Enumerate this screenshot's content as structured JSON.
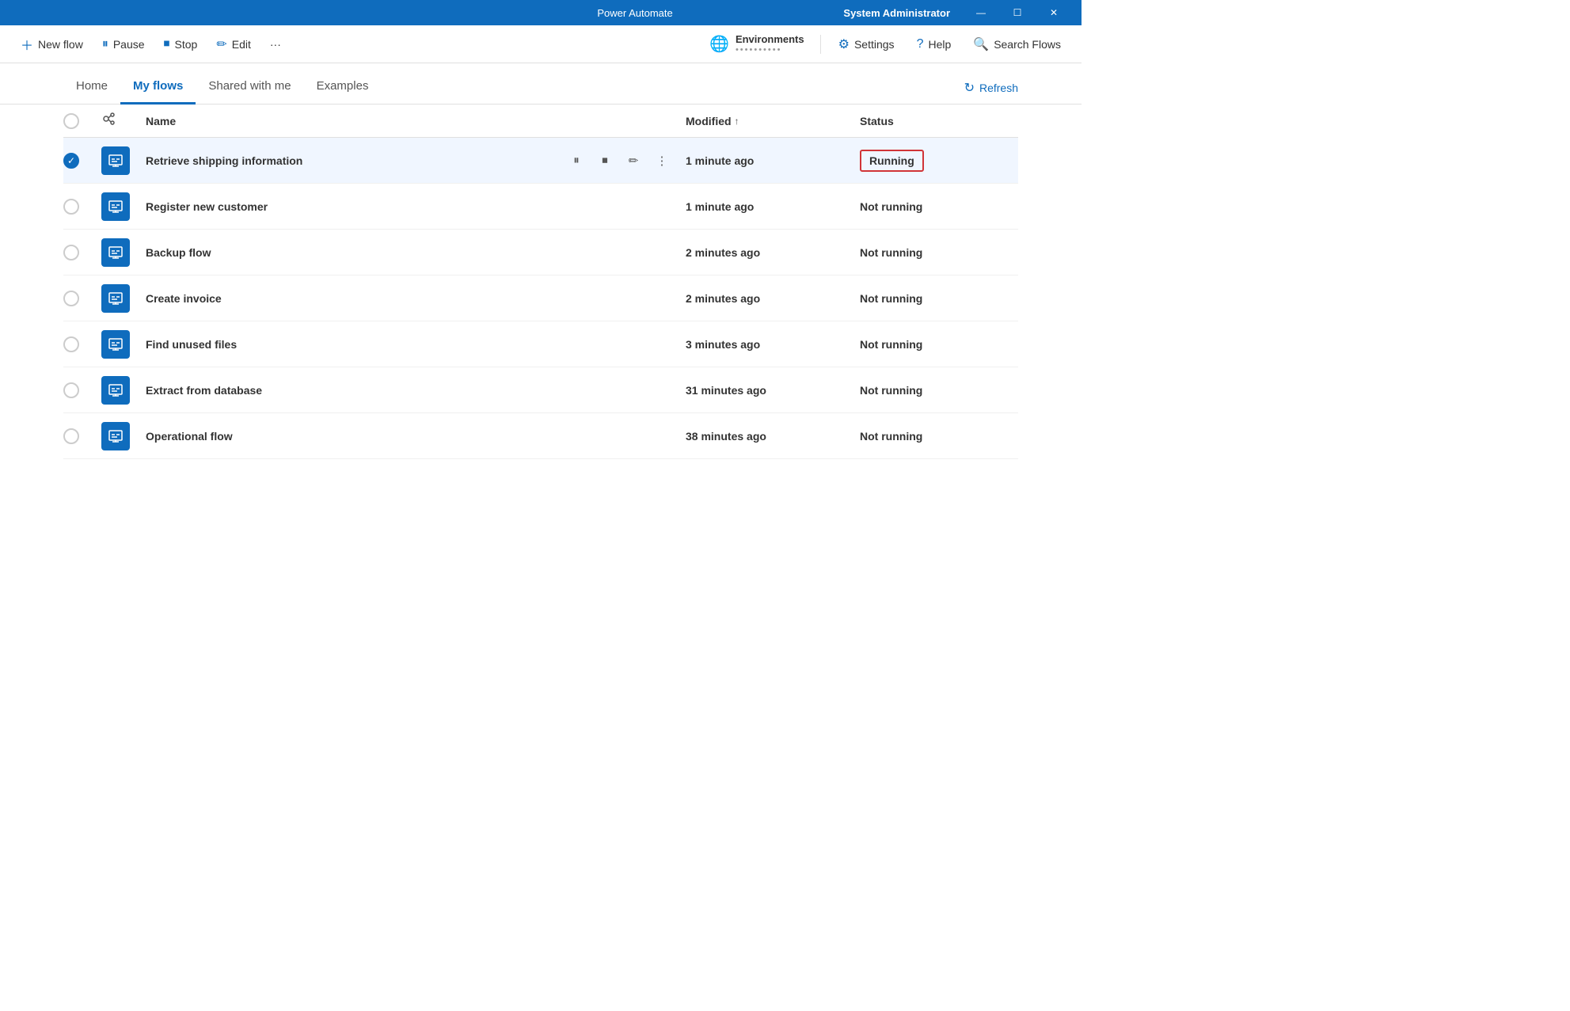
{
  "app": {
    "title": "Power Automate",
    "user": "System Administrator"
  },
  "titlebar": {
    "minimize": "—",
    "maximize": "☐",
    "close": "✕"
  },
  "toolbar": {
    "new_flow": "New flow",
    "pause": "Pause",
    "stop": "Stop",
    "edit": "Edit",
    "more": "···",
    "environments_label": "Environments",
    "environments_value": "••••••••••",
    "settings": "Settings",
    "help": "Help",
    "search_flows": "Search Flows"
  },
  "nav": {
    "tabs": [
      {
        "id": "home",
        "label": "Home",
        "active": false
      },
      {
        "id": "my-flows",
        "label": "My flows",
        "active": true
      },
      {
        "id": "shared-with-me",
        "label": "Shared with me",
        "active": false
      },
      {
        "id": "examples",
        "label": "Examples",
        "active": false
      }
    ],
    "refresh": "Refresh"
  },
  "table": {
    "headers": {
      "name": "Name",
      "modified": "Modified",
      "status": "Status"
    },
    "rows": [
      {
        "id": 1,
        "name": "Retrieve shipping information",
        "modified": "1 minute ago",
        "status": "Running",
        "selected": true,
        "running": true
      },
      {
        "id": 2,
        "name": "Register new customer",
        "modified": "1 minute ago",
        "status": "Not running",
        "selected": false,
        "running": false
      },
      {
        "id": 3,
        "name": "Backup flow",
        "modified": "2 minutes ago",
        "status": "Not running",
        "selected": false,
        "running": false
      },
      {
        "id": 4,
        "name": "Create invoice",
        "modified": "2 minutes ago",
        "status": "Not running",
        "selected": false,
        "running": false
      },
      {
        "id": 5,
        "name": "Find unused files",
        "modified": "3 minutes ago",
        "status": "Not running",
        "selected": false,
        "running": false
      },
      {
        "id": 6,
        "name": "Extract from database",
        "modified": "31 minutes ago",
        "status": "Not running",
        "selected": false,
        "running": false
      },
      {
        "id": 7,
        "name": "Operational flow",
        "modified": "38 minutes ago",
        "status": "Not running",
        "selected": false,
        "running": false
      }
    ]
  },
  "colors": {
    "accent": "#0f6cbd",
    "running_border": "#d13438"
  }
}
